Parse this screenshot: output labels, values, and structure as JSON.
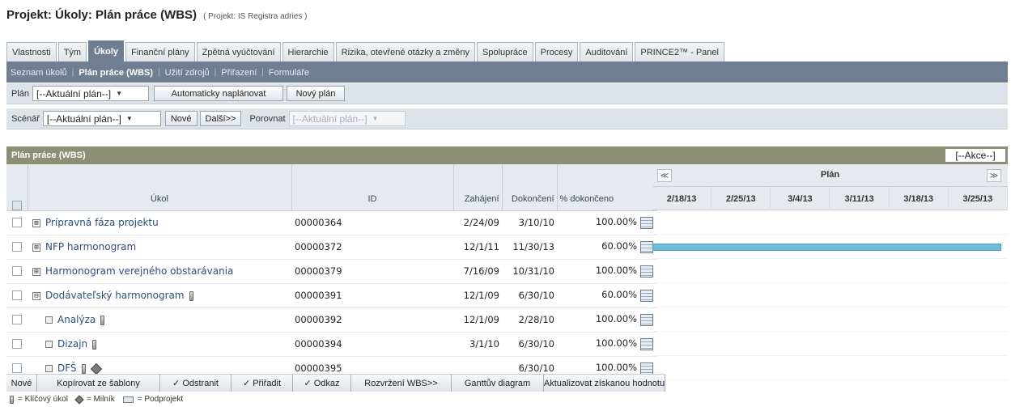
{
  "page": {
    "title": "Projekt: Úkoly: Plán práce (WBS)",
    "subtitle": "( Projekt: IS Registra adries )"
  },
  "tabs": [
    "Vlastnosti",
    "Tým",
    "Úkoly",
    "Finanční plány",
    "Zpětná vyúčtování",
    "Hierarchie",
    "Rizika, otevřené otázky a změny",
    "Spolupráce",
    "Procesy",
    "Auditování",
    "PRINCE2™ - Panel"
  ],
  "active_tab": "Úkoly",
  "subnav": [
    "Seznam úkolů",
    "Plán práce (WBS)",
    "Užití zdrojů",
    "Přiřazení",
    "Formuláře"
  ],
  "toolbar1": {
    "plan_label": "Plán",
    "plan_value": "[--Aktuální plán--]",
    "auto_schedule": "Automaticky naplánovat",
    "new_plan": "Nový plán"
  },
  "toolbar2": {
    "scenario_label": "Scénář",
    "scenario_value": "[--Aktuální plán--]",
    "new": "Nové",
    "next": "Další>>",
    "compare_label": "Porovnat",
    "compare_value": "[--Aktuální plán--]"
  },
  "panel": {
    "title": "Plán práce (WBS)",
    "actions": "[--Akce--]"
  },
  "columns": {
    "task": "Úkol",
    "id": "ID",
    "start": "Zahájení",
    "end": "Dokončení",
    "pct": "% dokončeno"
  },
  "rows": [
    {
      "task": "Prípravná fáza projektu",
      "id": "00000364",
      "start": "2/24/09",
      "end": "3/10/10",
      "pct": "100.00%",
      "kind": "summary",
      "expander": "⊞",
      "key": false,
      "milestone": false
    },
    {
      "task": "NFP harmonogram",
      "id": "00000372",
      "start": "12/1/11",
      "end": "11/30/13",
      "pct": "60.00%",
      "kind": "summary",
      "expander": "⊞",
      "key": false,
      "milestone": false
    },
    {
      "task": "Harmonogram verejného obstarávania",
      "id": "00000379",
      "start": "7/16/09",
      "end": "10/31/10",
      "pct": "100.00%",
      "kind": "summary",
      "expander": "⊞",
      "key": false,
      "milestone": false
    },
    {
      "task": "Dodávateľský harmonogram",
      "id": "00000391",
      "start": "12/1/09",
      "end": "6/30/10",
      "pct": "60.00%",
      "kind": "summary",
      "expander": "⊟",
      "key": true,
      "milestone": false
    },
    {
      "task": "Analýza",
      "id": "00000392",
      "start": "12/1/09",
      "end": "2/28/10",
      "pct": "100.00%",
      "kind": "child",
      "key": true,
      "milestone": false
    },
    {
      "task": "Dizajn",
      "id": "00000394",
      "start": "3/1/10",
      "end": "6/30/10",
      "pct": "100.00%",
      "kind": "child",
      "key": true,
      "milestone": false
    },
    {
      "task": "DFŠ",
      "id": "00000395",
      "start": "",
      "end": "6/30/10",
      "pct": "100.00%",
      "kind": "child",
      "key": true,
      "milestone": true
    }
  ],
  "gantt": {
    "title": "Plán",
    "prev": "≪",
    "next": "≫",
    "dates": [
      "2/18/13",
      "2/25/13",
      "3/4/13",
      "3/11/13",
      "3/18/13",
      "3/25/13"
    ],
    "bar_color": "#6fbcd8",
    "bar_rows": [
      1
    ]
  },
  "bottom_buttons": [
    "Nové",
    "Kopírovat ze šablony",
    "✓ Odstranit",
    "✓ Přiřadit",
    "✓ Odkaz",
    "Rozvržení WBS>>",
    "Ganttův diagram",
    "Aktualizovat získanou hodnotu"
  ],
  "legend": {
    "key_task": "= Klíčový úkol",
    "milestone": "= Milník",
    "subproject": "= Podprojekt"
  }
}
